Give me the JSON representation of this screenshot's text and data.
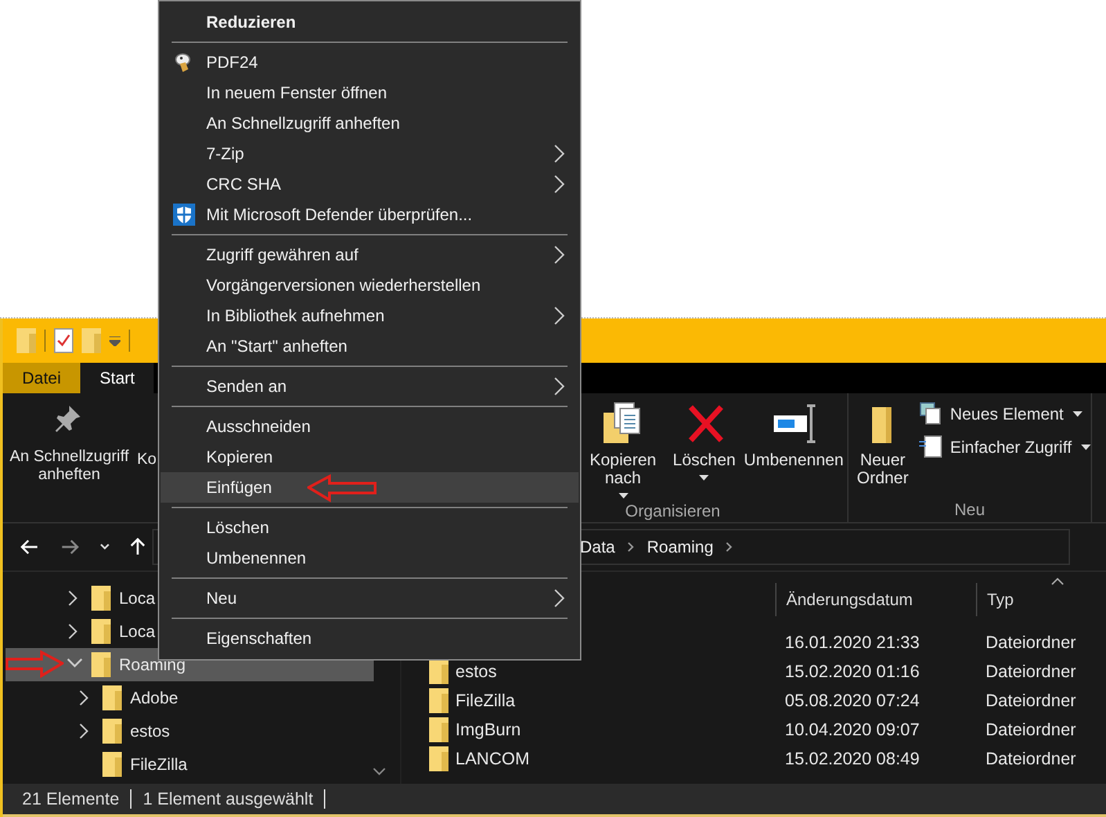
{
  "ribbon": {
    "tabs": [
      {
        "label": "Datei",
        "kind": "file",
        "selected": false
      },
      {
        "label": "Start",
        "kind": "tab",
        "selected": true
      }
    ],
    "clipboard_buttons": [
      {
        "label": "An Schnellzugriff anheften"
      },
      {
        "label": "Ko"
      }
    ],
    "groups": [
      {
        "name": "Organisieren",
        "buttons": [
          {
            "label": "Kopieren nach",
            "kind": "large",
            "dropdown": true
          },
          {
            "label": "Löschen",
            "kind": "large",
            "dropdown": true
          },
          {
            "label": "Umbenennen",
            "kind": "large",
            "dropdown": false
          }
        ]
      },
      {
        "name": "Neu",
        "buttons": [
          {
            "label": "Neuer Ordner",
            "kind": "large",
            "dropdown": false
          },
          {
            "label": "Neues Element",
            "kind": "small",
            "dropdown": true
          },
          {
            "label": "Einfacher Zugriff",
            "kind": "small",
            "dropdown": true
          }
        ]
      }
    ]
  },
  "address_bar": {
    "breadcrumbs": [
      "Data",
      "Roaming"
    ]
  },
  "navigation_pane": {
    "items": [
      {
        "label": "Loca",
        "expandable": true,
        "expanded": false,
        "selected": false
      },
      {
        "label": "Loca",
        "expandable": true,
        "expanded": false,
        "selected": false
      },
      {
        "label": "Roaming",
        "expandable": true,
        "expanded": true,
        "selected": true,
        "children": [
          {
            "label": "Adobe",
            "expandable": true,
            "expanded": false,
            "selected": false
          },
          {
            "label": "estos",
            "expandable": true,
            "expanded": false,
            "selected": false
          },
          {
            "label": "FileZilla",
            "expandable": false,
            "selected": false
          }
        ]
      }
    ]
  },
  "file_list": {
    "columns": [
      {
        "label": "Änderungsdatum",
        "sorted": false
      },
      {
        "label": "Typ",
        "sorted": true
      }
    ],
    "rows": [
      {
        "date": "16.01.2020 21:33",
        "type": "Dateiordner"
      },
      {
        "name": "estos",
        "date": "15.02.2020 01:16",
        "type": "Dateiordner"
      },
      {
        "name": "FileZilla",
        "date": "05.08.2020 07:24",
        "type": "Dateiordner"
      },
      {
        "name": "ImgBurn",
        "date": "10.04.2020 09:07",
        "type": "Dateiordner"
      },
      {
        "name": "LANCOM",
        "date": "15.02.2020 08:49",
        "type": "Dateiordner"
      }
    ]
  },
  "status_bar": {
    "item_count": "21 Elemente",
    "selection": "1 Element ausgewählt"
  },
  "context_menu": {
    "items": [
      {
        "kind": "header",
        "label": "Reduzieren",
        "submenu": false,
        "selected": false
      },
      {
        "kind": "separator"
      },
      {
        "kind": "app",
        "label": "PDF24",
        "submenu": false,
        "selected": false
      },
      {
        "kind": "item",
        "label": "In neuem Fenster öffnen",
        "submenu": false,
        "selected": false
      },
      {
        "kind": "item",
        "label": "An Schnellzugriff anheften",
        "submenu": false,
        "selected": false
      },
      {
        "kind": "item",
        "label": "7-Zip",
        "submenu": true,
        "selected": false
      },
      {
        "kind": "item",
        "label": "CRC SHA",
        "submenu": true,
        "selected": false
      },
      {
        "kind": "scan",
        "label": "Mit Microsoft Defender überprüfen...",
        "submenu": false,
        "selected": false
      },
      {
        "kind": "separator"
      },
      {
        "kind": "item",
        "label": "Zugriff gewähren auf",
        "submenu": true,
        "selected": false
      },
      {
        "kind": "item",
        "label": "Vorgängerversionen wiederherstellen",
        "submenu": false,
        "selected": false
      },
      {
        "kind": "item",
        "label": "In Bibliothek aufnehmen",
        "submenu": true,
        "selected": false
      },
      {
        "kind": "item",
        "label": "An \"Start\" anheften",
        "submenu": false,
        "selected": false
      },
      {
        "kind": "separator"
      },
      {
        "kind": "item",
        "label": "Senden an",
        "submenu": true,
        "selected": false
      },
      {
        "kind": "separator"
      },
      {
        "kind": "item",
        "label": "Ausschneiden",
        "submenu": false,
        "selected": false
      },
      {
        "kind": "item",
        "label": "Kopieren",
        "submenu": false,
        "selected": false
      },
      {
        "kind": "item",
        "label": "Einfügen",
        "submenu": false,
        "selected": true
      },
      {
        "kind": "separator"
      },
      {
        "kind": "item",
        "label": "Löschen",
        "submenu": false,
        "selected": false
      },
      {
        "kind": "item",
        "label": "Umbenennen",
        "submenu": false,
        "selected": false
      },
      {
        "kind": "separator"
      },
      {
        "kind": "item",
        "label": "Neu",
        "submenu": true,
        "selected": false
      },
      {
        "kind": "separator"
      },
      {
        "kind": "item",
        "label": "Eigenschaften",
        "submenu": false,
        "selected": false
      }
    ]
  }
}
